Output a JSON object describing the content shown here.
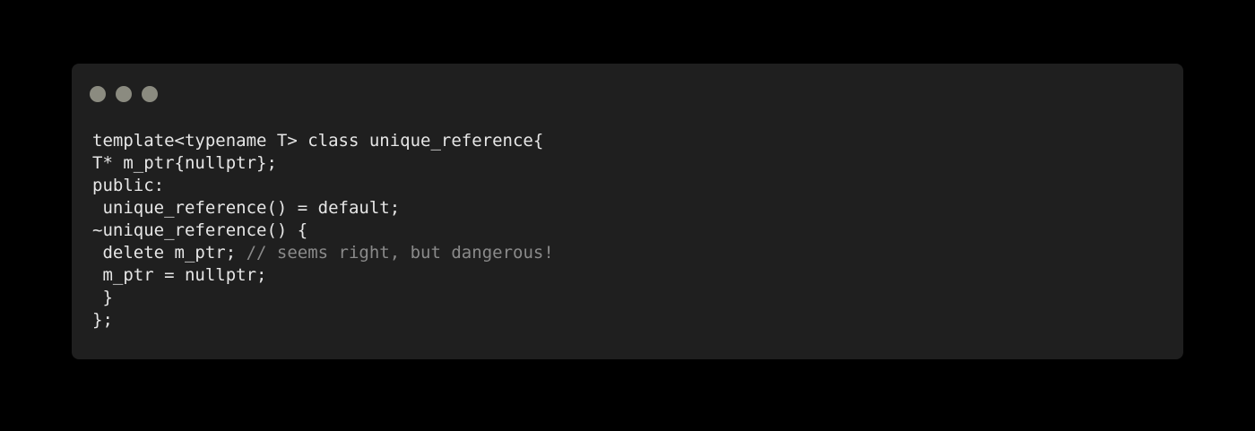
{
  "window": {
    "controls": [
      {
        "name": "close",
        "color": "#8b8b80"
      },
      {
        "name": "minimize",
        "color": "#8b8b80"
      },
      {
        "name": "zoom",
        "color": "#8b8b80"
      }
    ]
  },
  "code": {
    "lines": [
      {
        "text": "template<typename T> class unique_reference{",
        "comment": ""
      },
      {
        "text": "T* m_ptr{nullptr};",
        "comment": ""
      },
      {
        "text": "public:",
        "comment": ""
      },
      {
        "text": " unique_reference() = default;",
        "comment": ""
      },
      {
        "text": "~unique_reference() {",
        "comment": ""
      },
      {
        "text": " delete m_ptr; ",
        "comment": "// seems right, but dangerous!"
      },
      {
        "text": " m_ptr = nullptr;",
        "comment": ""
      },
      {
        "text": " }",
        "comment": ""
      },
      {
        "text": "};",
        "comment": ""
      }
    ]
  },
  "colors": {
    "background": "#000000",
    "window": "#1f1f1f",
    "text": "#e6e6e6",
    "comment": "#8a8a8a"
  }
}
